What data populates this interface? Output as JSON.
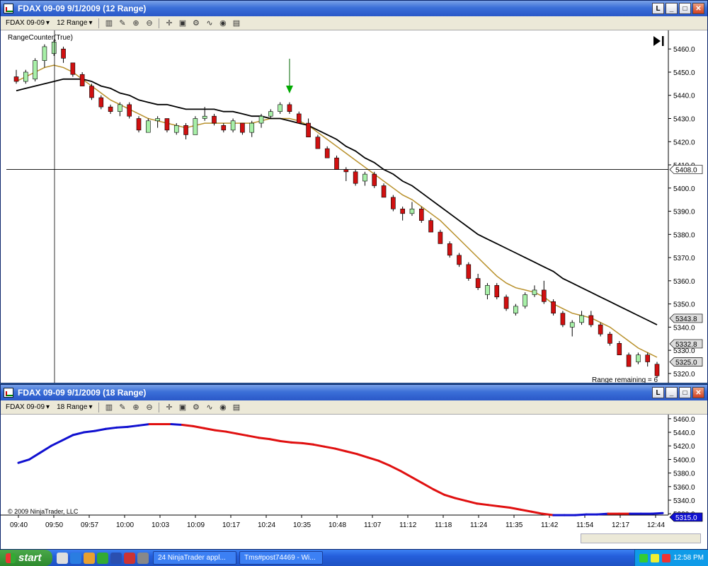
{
  "top": {
    "title": "FDAX 09-09  9/1/2009 (12 Range)",
    "instrument": "FDAX 09-09",
    "interval": "12 Range",
    "indicator": "RangeCounter(True)",
    "copyright": "© 2009 NinjaTrader, LLC",
    "range_remaining": "Range remaining = 6",
    "price_ticks": [
      "5460.0",
      "5450.0",
      "5440.0",
      "5430.0",
      "5420.0",
      "5410.0",
      "5400.0",
      "5390.0",
      "5380.0",
      "5370.0",
      "5360.0",
      "5350.0",
      "5340.0",
      "5330.0",
      "5320.0"
    ],
    "crosshair_label": "5408.0",
    "markers": [
      "5343.8",
      "5332.8",
      "5325.0"
    ]
  },
  "bottom": {
    "title": "FDAX 09-09  9/1/2009 (18 Range)",
    "instrument": "FDAX 09-09",
    "interval": "18 Range",
    "copyright": "© 2009 NinjaTrader, LLC",
    "price_ticks": [
      "5460.0",
      "5440.0",
      "5420.0",
      "5400.0",
      "5380.0",
      "5360.0",
      "5340.0",
      "5320.0"
    ],
    "last_label": "5315.0",
    "time_ticks": [
      "09:40",
      "09:50",
      "09:57",
      "10:00",
      "10:03",
      "10:09",
      "10:17",
      "10:24",
      "10:35",
      "10:48",
      "11:07",
      "11:12",
      "11:18",
      "11:24",
      "11:35",
      "11:42",
      "11:54",
      "12:17",
      "12:44"
    ]
  },
  "window_buttons": {
    "l": "L",
    "min": "_",
    "max": "□",
    "close": "✕"
  },
  "taskbar": {
    "start": "start",
    "task1": "24 NinjaTrader appl...",
    "task2": "Tms#post74469 - Wi...",
    "clock": "12:58 PM"
  },
  "chart_data": [
    {
      "type": "candlestick",
      "title": "FDAX 09-09  9/1/2009 (12 Range)",
      "ylim": [
        5316,
        5468
      ],
      "ohlc": [
        [
          5448,
          5451,
          5445,
          5446
        ],
        [
          5446,
          5451,
          5445,
          5450
        ],
        [
          5447,
          5456,
          5446,
          5455
        ],
        [
          5455,
          5462,
          5452,
          5461
        ],
        [
          5458,
          5464,
          5457,
          5463
        ],
        [
          5460,
          5461,
          5454,
          5456
        ],
        [
          5454,
          5454,
          5448,
          5449
        ],
        [
          5449,
          5450,
          5444,
          5444
        ],
        [
          5444,
          5445,
          5438,
          5439
        ],
        [
          5439,
          5440,
          5434,
          5435
        ],
        [
          5435,
          5436,
          5432,
          5433
        ],
        [
          5433,
          5437,
          5431,
          5436
        ],
        [
          5436,
          5437,
          5430,
          5431
        ],
        [
          5430,
          5431,
          5424,
          5425
        ],
        [
          5424,
          5430,
          5424,
          5429
        ],
        [
          5429,
          5431,
          5426,
          5430
        ],
        [
          5430,
          5430,
          5424,
          5425
        ],
        [
          5424,
          5428,
          5423,
          5427
        ],
        [
          5427,
          5428,
          5421,
          5423
        ],
        [
          5423,
          5431,
          5423,
          5430
        ],
        [
          5430,
          5435,
          5429,
          5431
        ],
        [
          5431,
          5432,
          5427,
          5428
        ],
        [
          5427,
          5428,
          5424,
          5425
        ],
        [
          5425,
          5430,
          5424,
          5429
        ],
        [
          5428,
          5428,
          5423,
          5424
        ],
        [
          5424,
          5429,
          5422,
          5428
        ],
        [
          5428,
          5432,
          5426,
          5431
        ],
        [
          5431,
          5434,
          5430,
          5433
        ],
        [
          5433,
          5437,
          5432,
          5436
        ],
        [
          5436,
          5437,
          5432,
          5433
        ],
        [
          5432,
          5433,
          5428,
          5428
        ],
        [
          5428,
          5430,
          5422,
          5422
        ],
        [
          5422,
          5423,
          5417,
          5417
        ],
        [
          5417,
          5418,
          5413,
          5413
        ],
        [
          5413,
          5414,
          5408,
          5408
        ],
        [
          5408,
          5409,
          5403,
          5407
        ],
        [
          5407,
          5408,
          5401,
          5402
        ],
        [
          5403,
          5407,
          5401,
          5406
        ],
        [
          5406,
          5407,
          5400,
          5401
        ],
        [
          5401,
          5402,
          5396,
          5396
        ],
        [
          5396,
          5397,
          5390,
          5391
        ],
        [
          5391,
          5392,
          5386,
          5389
        ],
        [
          5389,
          5394,
          5388,
          5391
        ],
        [
          5391,
          5392,
          5385,
          5386
        ],
        [
          5386,
          5387,
          5381,
          5381
        ],
        [
          5381,
          5382,
          5376,
          5376
        ],
        [
          5376,
          5377,
          5370,
          5371
        ],
        [
          5371,
          5372,
          5366,
          5367
        ],
        [
          5367,
          5368,
          5360,
          5361
        ],
        [
          5361,
          5363,
          5356,
          5357
        ],
        [
          5354,
          5359,
          5352,
          5358
        ],
        [
          5358,
          5359,
          5352,
          5353
        ],
        [
          5353,
          5354,
          5347,
          5348
        ],
        [
          5346,
          5350,
          5345,
          5349
        ],
        [
          5349,
          5355,
          5348,
          5354
        ],
        [
          5354,
          5358,
          5353,
          5356
        ],
        [
          5356,
          5360,
          5350,
          5351
        ],
        [
          5351,
          5352,
          5345,
          5346
        ],
        [
          5346,
          5347,
          5340,
          5341
        ],
        [
          5340,
          5343,
          5336,
          5342
        ],
        [
          5342,
          5347,
          5341,
          5345
        ],
        [
          5345,
          5347,
          5340,
          5341
        ],
        [
          5341,
          5342,
          5336,
          5337
        ],
        [
          5337,
          5338,
          5332,
          5333
        ],
        [
          5333,
          5334,
          5328,
          5328
        ],
        [
          5328,
          5329,
          5323,
          5323
        ],
        [
          5325,
          5329,
          5324,
          5328
        ],
        [
          5328,
          5329,
          5323,
          5325
        ],
        [
          5324,
          5325,
          5318,
          5319
        ]
      ],
      "series": [
        {
          "values": [
            5446,
            5448,
            5450,
            5452,
            5453,
            5452,
            5450,
            5447,
            5444,
            5441,
            5438,
            5436,
            5434,
            5432,
            5430,
            5429,
            5428,
            5427,
            5426,
            5427,
            5428,
            5428,
            5428,
            5428,
            5428,
            5428,
            5429,
            5430,
            5430,
            5430,
            5429,
            5427,
            5424,
            5421,
            5418,
            5415,
            5412,
            5409,
            5406,
            5403,
            5400,
            5397,
            5395,
            5392,
            5389,
            5386,
            5382,
            5378,
            5374,
            5370,
            5366,
            5362,
            5359,
            5357,
            5356,
            5355,
            5353,
            5350,
            5348,
            5346,
            5345,
            5344,
            5342,
            5340,
            5337,
            5334,
            5331,
            5329,
            5327
          ]
        },
        {
          "values": [
            5442,
            5443,
            5444,
            5445,
            5446,
            5447,
            5447,
            5447,
            5446,
            5444,
            5443,
            5441,
            5440,
            5438,
            5437,
            5436,
            5436,
            5435,
            5434,
            5434,
            5434,
            5434,
            5433,
            5433,
            5432,
            5431,
            5431,
            5430,
            5430,
            5429,
            5428,
            5427,
            5425,
            5423,
            5421,
            5418,
            5416,
            5413,
            5411,
            5408,
            5406,
            5403,
            5401,
            5398,
            5395,
            5392,
            5389,
            5386,
            5383,
            5380,
            5378,
            5376,
            5374,
            5372,
            5370,
            5368,
            5366,
            5364,
            5361,
            5359,
            5357,
            5355,
            5353,
            5351,
            5349,
            5347,
            5345,
            5343,
            5341
          ]
        }
      ]
    },
    {
      "type": "line",
      "title": "FDAX 09-09  9/1/2009 (18 Range)",
      "ylim": [
        5316,
        5464
      ],
      "values": [
        5395,
        5400,
        5410,
        5420,
        5428,
        5436,
        5440,
        5442,
        5445,
        5447,
        5448,
        5450,
        5452,
        5452,
        5452,
        5451,
        5449,
        5446,
        5443,
        5441,
        5438,
        5435,
        5432,
        5430,
        5427,
        5425,
        5424,
        5422,
        5419,
        5416,
        5412,
        5408,
        5403,
        5398,
        5391,
        5383,
        5374,
        5365,
        5356,
        5348,
        5343,
        5339,
        5335,
        5333,
        5331,
        5329,
        5326,
        5323,
        5320,
        5318,
        5318,
        5318,
        5319,
        5319,
        5320,
        5320,
        5320,
        5320,
        5320,
        5321
      ],
      "colors": [
        "blue",
        "blue",
        "blue",
        "blue",
        "blue",
        "blue",
        "blue",
        "blue",
        "blue",
        "blue",
        "blue",
        "blue",
        "red",
        "red",
        "blue",
        "red",
        "red",
        "red",
        "red",
        "red",
        "red",
        "red",
        "red",
        "red",
        "red",
        "red",
        "red",
        "red",
        "red",
        "red",
        "red",
        "red",
        "red",
        "red",
        "red",
        "red",
        "red",
        "red",
        "red",
        "red",
        "red",
        "red",
        "red",
        "red",
        "red",
        "red",
        "red",
        "red",
        "red",
        "blue",
        "blue",
        "blue",
        "blue",
        "blue",
        "red",
        "red",
        "blue",
        "blue",
        "blue",
        "blue"
      ]
    }
  ]
}
